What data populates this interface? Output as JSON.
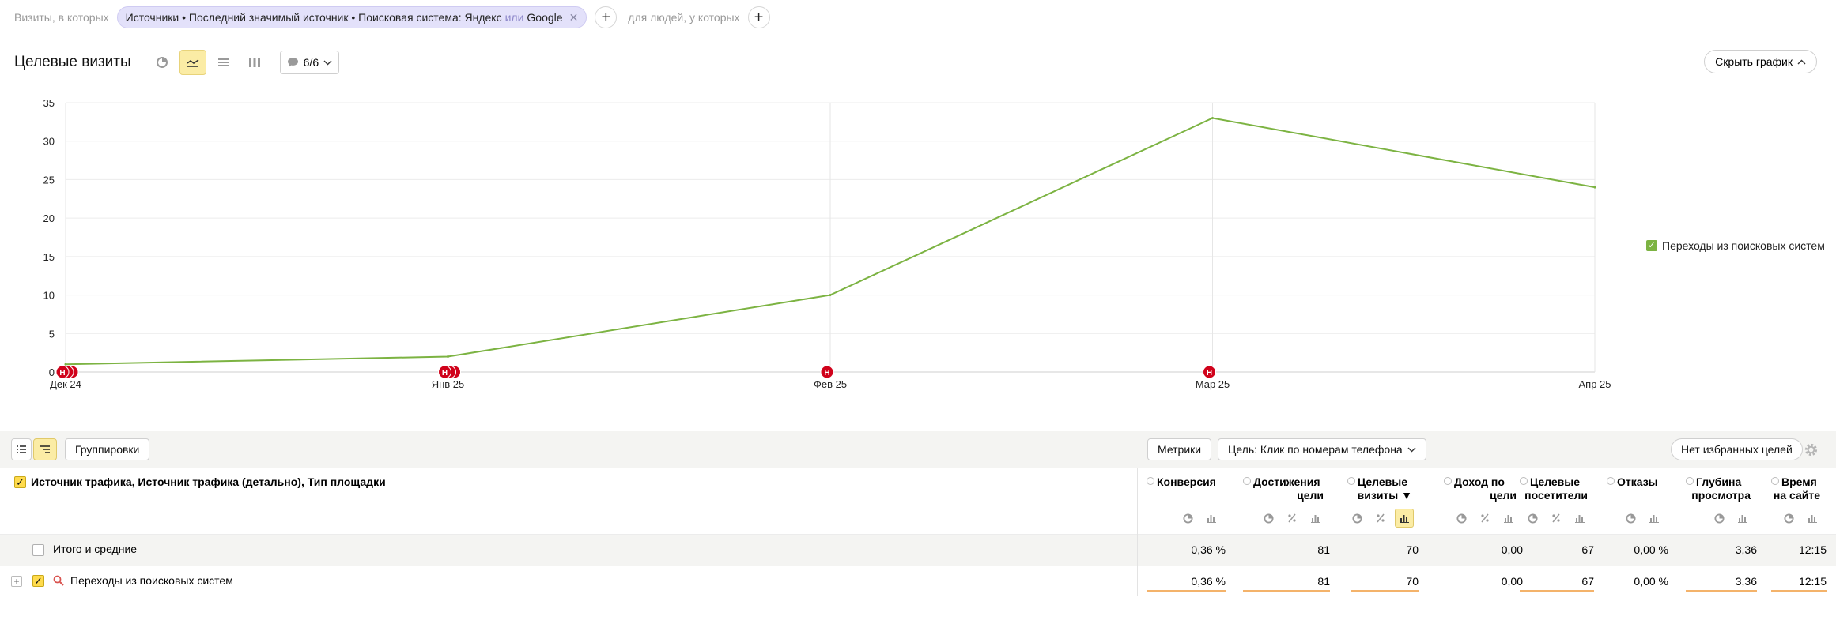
{
  "filters": {
    "visits_label": "Визиты, в которых",
    "segment": {
      "part1": "Источники • Последний значимый источник • Поисковая система: Яндекс",
      "or": "или",
      "part2": "Google"
    },
    "people_label": "для людей, у которых"
  },
  "chart_header": {
    "title": "Целевые визиты",
    "goal_count": "6/6",
    "hide_chart": "Скрыть график"
  },
  "chart_data": {
    "type": "line",
    "categories": [
      "Дек 24",
      "Янв 25",
      "Фев 25",
      "Мар 25",
      "Апр 25"
    ],
    "series": [
      {
        "name": "Переходы из поисковых систем",
        "values": [
          1,
          2,
          10,
          33,
          24
        ],
        "color": "#7cb342"
      }
    ],
    "ylim": [
      0,
      35
    ],
    "yticks": [
      0,
      5,
      10,
      15,
      20,
      25,
      30,
      35
    ],
    "annotations": [
      {
        "x_index": 0,
        "label": "Н"
      },
      {
        "x_index": 1,
        "label": "Н"
      },
      {
        "x_index": 2,
        "label": "Н"
      },
      {
        "x_index": 3,
        "label": "Н"
      }
    ],
    "grid": true,
    "legend_position": "right"
  },
  "toolbar": {
    "groupings": "Группировки",
    "metrics": "Метрики",
    "goal": "Цель: Клик по номерам телефона",
    "favorites": "Нет избранных целей"
  },
  "table": {
    "dimension_header": "Источник трафика, Источник трафика (детально), Тип площадки",
    "columns": [
      {
        "l1": "Конверсия",
        "l2": ""
      },
      {
        "l1": "Достижения",
        "l2": "цели"
      },
      {
        "l1": "Целевые",
        "l2": "визиты ▼"
      },
      {
        "l1": "Доход по",
        "l2": "цели"
      },
      {
        "l1": "Целевые",
        "l2": "посетители"
      },
      {
        "l1": "Отказы",
        "l2": ""
      },
      {
        "l1": "Глубина",
        "l2": "просмотра"
      },
      {
        "l1": "Время",
        "l2": "на сайте"
      }
    ],
    "total": {
      "label": "Итого и средние",
      "values": [
        "0,36 %",
        "81",
        "70",
        "0,00",
        "67",
        "0,00 %",
        "3,36",
        "12:15"
      ]
    },
    "rows": [
      {
        "label": "Переходы из поисковых систем",
        "values": [
          "0,36 %",
          "81",
          "70",
          "0,00",
          "67",
          "0,00 %",
          "3,36",
          "12:15"
        ]
      }
    ]
  }
}
